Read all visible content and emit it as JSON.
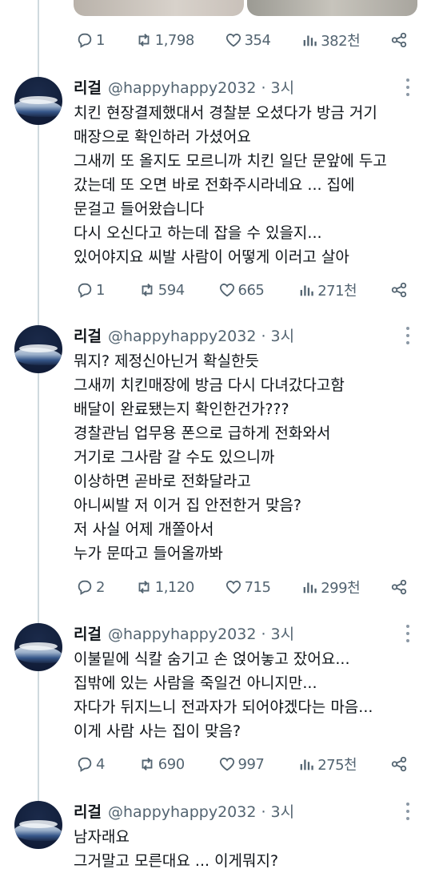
{
  "top_actions": {
    "replies": "1",
    "retweets": "1,798",
    "likes": "354",
    "views": "382천"
  },
  "tweets": [
    {
      "name": "리걸",
      "handle": "@happyhappy2032 · 3시",
      "lines": [
        "치킨 현장결제했대서 경찰분 오셨다가 방금 거기",
        "매장으로 확인하러 가셨어요",
        "그새끼 또 올지도 모르니까 치킨 일단 문앞에 두고",
        "갔는데 또 오면 바로 전화주시라네요 ... 집에",
        "문걸고 들어왔습니다",
        "다시 오신다고 하는데 잡을 수 있을지...",
        "있어야지요 씨발 사람이 어떻게 이러고 살아"
      ],
      "actions": {
        "replies": "1",
        "retweets": "594",
        "likes": "665",
        "views": "271천"
      }
    },
    {
      "name": "리걸",
      "handle": "@happyhappy2032 · 3시",
      "lines": [
        "뭐지? 제정신아닌거 확실한듯",
        "그새끼 치킨매장에 방금 다시 다녀갔다고함",
        "배달이 완료됐는지 확인한건가???",
        "경찰관님 업무용 폰으로 급하게 전화와서",
        "거기로 그사람 갈 수도 있으니까",
        "이상하면 곧바로 전화달라고",
        "아니씨발 저 이거 집 안전한거 맞음?",
        "저 사실 어제 개쫄아서",
        "누가 문따고 들어올까봐"
      ],
      "actions": {
        "replies": "2",
        "retweets": "1,120",
        "likes": "715",
        "views": "299천"
      }
    },
    {
      "name": "리걸",
      "handle": "@happyhappy2032 · 3시",
      "lines": [
        "이불밑에 식칼 숨기고 손 얹어놓고 잤어요...",
        "집밖에 있는 사람을 죽일건 아니지만...",
        "자다가 뒤지느니 전과자가 되어야겠다는 마음...",
        "이게 사람 사는 집이 맞음?"
      ],
      "actions": {
        "replies": "4",
        "retweets": "690",
        "likes": "997",
        "views": "275천"
      }
    },
    {
      "name": "리걸",
      "handle": "@happyhappy2032 · 3시",
      "lines": [
        "남자래요",
        "그거말고 모른대요 ... 이게뭐지?"
      ]
    }
  ]
}
